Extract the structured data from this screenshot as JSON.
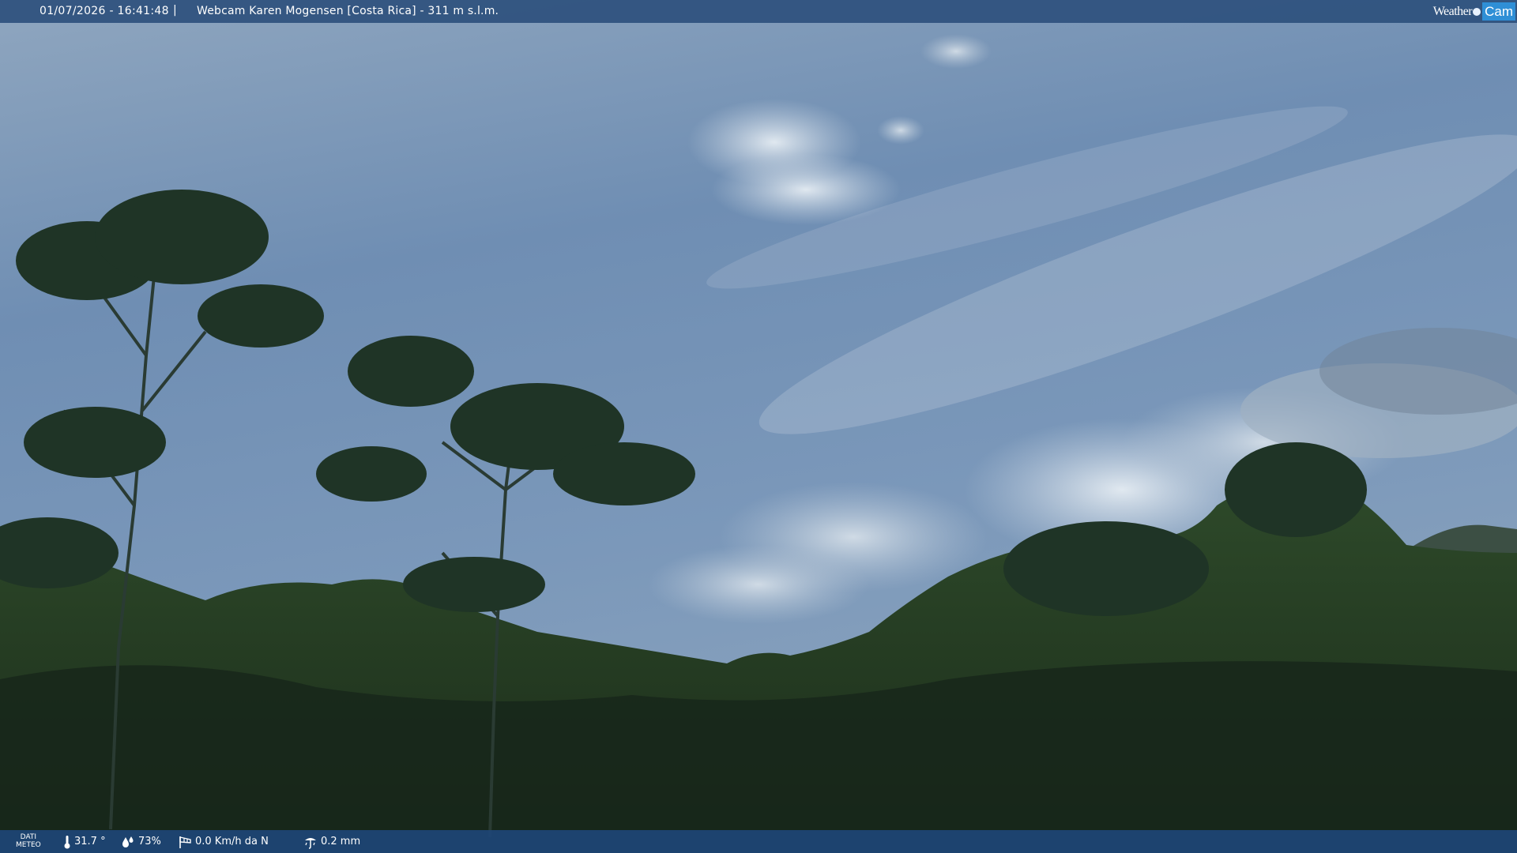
{
  "overlay": {
    "datetime": "01/07/2026 - 16:41:48",
    "separator": "|",
    "title": "Webcam Karen Mogensen [Costa Rica] - 311 m s.l.m.",
    "brand_weather": "Weather",
    "brand_cam": "Cam"
  },
  "meteo": {
    "label_line1": "DATI",
    "label_line2": "METEO",
    "temperature": "31.7 °",
    "humidity": "73%",
    "wind": "0.0 Km/h da N",
    "rain": "0.2 mm"
  },
  "icons": [
    "thermometer-icon",
    "humidity-drops-icon",
    "wind-sock-icon",
    "rain-gauge-icon"
  ],
  "colors": {
    "bar": "#2e507d",
    "brand_accent": "#2f8fd6"
  }
}
